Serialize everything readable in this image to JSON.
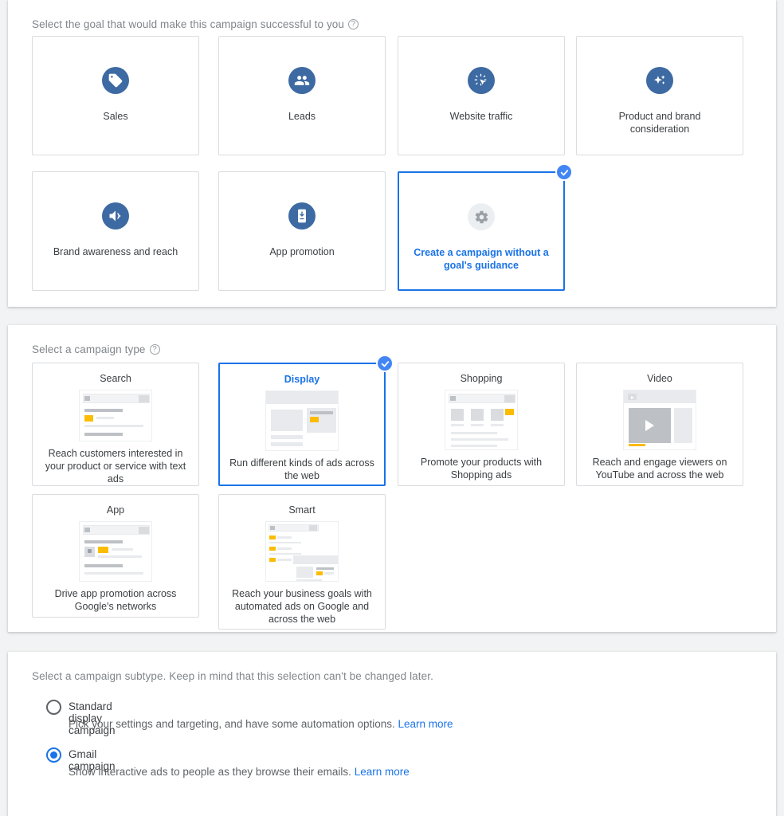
{
  "page": {
    "background": "#f1f3f4",
    "accent_blue": "#1a73e8",
    "icon_blue": "#3d6aa2",
    "badge_yellow": "#fbbc04"
  },
  "goals_section": {
    "label": "Select the goal that would make this campaign successful to you",
    "help_icon": "help-circle-icon",
    "cards": [
      {
        "label": "Sales",
        "icon": "price-tag-icon",
        "selected": false
      },
      {
        "label": "Leads",
        "icon": "people-group-icon",
        "selected": false
      },
      {
        "label": "Website traffic",
        "icon": "cursor-click-icon",
        "selected": false
      },
      {
        "label": "Product and brand consideration",
        "icon": "sparkle-icon",
        "selected": false
      },
      {
        "label": "Brand awareness and reach",
        "icon": "megaphone-speaker-icon",
        "selected": false
      },
      {
        "label": "App promotion",
        "icon": "mobile-download-icon",
        "selected": false
      },
      {
        "label": "Create a campaign without a goal's guidance",
        "icon": "gear-icon",
        "selected": true
      }
    ]
  },
  "types_section": {
    "label": "Select a campaign type",
    "help_icon": "help-circle-icon",
    "cards": [
      {
        "title": "Search",
        "desc": "Reach customers interested in your product or service with text ads",
        "thumb": "search-serp-thumb",
        "selected": false
      },
      {
        "title": "Display",
        "desc": "Run different kinds of ads across the web",
        "thumb": "display-banner-thumb",
        "selected": true
      },
      {
        "title": "Shopping",
        "desc": "Promote your products with Shopping ads",
        "thumb": "shopping-tiles-thumb",
        "selected": false
      },
      {
        "title": "Video",
        "desc": "Reach and engage viewers on YouTube and across the web",
        "thumb": "video-player-thumb",
        "selected": false
      },
      {
        "title": "App",
        "desc": "Drive app promotion across Google's networks",
        "thumb": "app-install-thumb",
        "selected": false
      },
      {
        "title": "Smart",
        "desc": "Reach your business goals with automated ads on Google and across the web",
        "thumb": "smart-combo-thumb",
        "selected": false
      }
    ]
  },
  "subtypes_section": {
    "label": "Select a campaign subtype. Keep in mind that this selection can't be changed later.",
    "options": [
      {
        "title": "Standard display campaign",
        "desc": "Pick your settings and targeting, and have some automation options.",
        "link": "Learn more",
        "selected": false
      },
      {
        "title": "Gmail campaign",
        "desc": "Show interactive ads to people as they browse their emails.",
        "link": "Learn more",
        "selected": true
      }
    ]
  }
}
